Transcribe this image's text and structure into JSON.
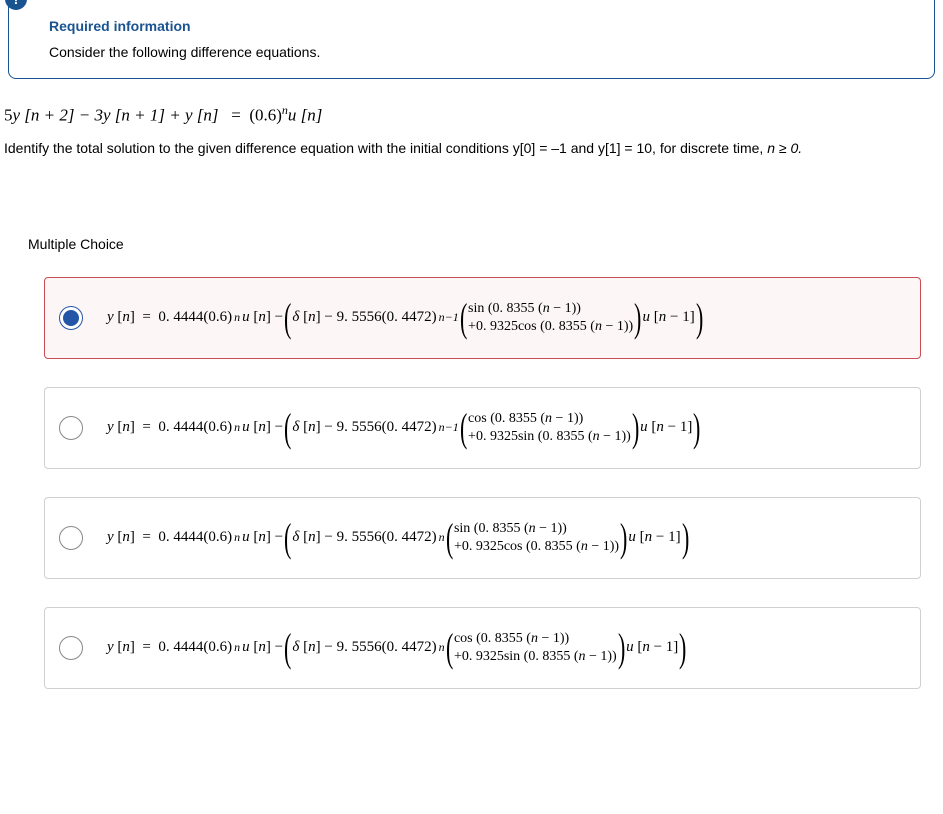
{
  "info": {
    "badge": "!",
    "title": "Required information",
    "subtitle": "Consider the following difference equations."
  },
  "equation": {
    "lhs_a": "5",
    "lhs_b": "y [n + 2] − 3y [n + 1] + y [n]",
    "rhs_base": "(0.6)",
    "rhs_exp": "n",
    "rhs_tail": "u [n]"
  },
  "prompt_a": "Identify the total solution to the given difference equation with the initial conditions y[0] = –1 and y[1] = 10, for discrete time, ",
  "prompt_b": "n ≥ 0.",
  "mc_label": "Multiple Choice",
  "common": {
    "yn_eq": "y [n]   =   0. 4444(0.6)",
    "exp_n": "n",
    "u_n": "u [n] − ",
    "delta_n": "δ [n] − 9. 5556(0. 4472)",
    "exp_nm1": "n−1",
    "u_nm1": "u [n − 1]"
  },
  "choices": [
    {
      "selected": true,
      "exp2": "n−1",
      "row1": "sin (0. 8355 (n − 1))",
      "row2": "+0. 9325cos (0. 8355 (n − 1))"
    },
    {
      "selected": false,
      "exp2": "n−1",
      "row1": "cos (0. 8355 (n − 1))",
      "row2": "+0. 9325sin (0. 8355 (n − 1))"
    },
    {
      "selected": false,
      "exp2": "n",
      "row1": "sin (0. 8355 (n − 1))",
      "row2": "+0. 9325cos (0. 8355 (n − 1))"
    },
    {
      "selected": false,
      "exp2": "n",
      "row1": "cos (0. 8355 (n − 1))",
      "row2": "+0. 9325sin (0. 8355 (n − 1))"
    }
  ]
}
